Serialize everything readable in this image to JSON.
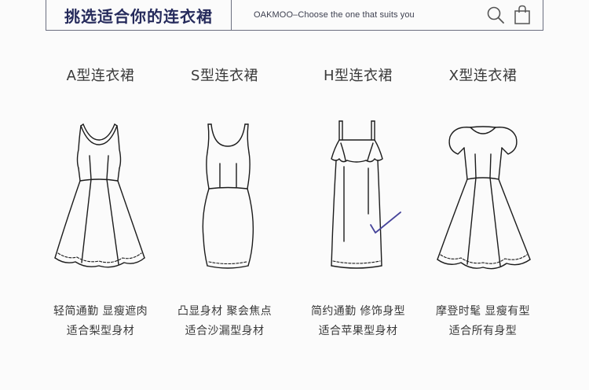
{
  "header": {
    "title": "挑选适合你的连衣裙",
    "search_text": "OAKMOO–Choose the one that suits you",
    "icons": [
      "search-icon",
      "shopping-bag-icon"
    ]
  },
  "styles": [
    {
      "title": "A型连衣裙",
      "line1": "轻简通勤 显瘦遮肉",
      "line2": "适合梨型身材"
    },
    {
      "title": "S型连衣裙",
      "line1": "凸显身材 聚会焦点",
      "line2": "适合沙漏型身材"
    },
    {
      "title": "H型连衣裙",
      "line1": "简约通勤 修饰身型",
      "line2": "适合苹果型身材"
    },
    {
      "title": "X型连衣裙",
      "line1": "摩登时髦 显瘦有型",
      "line2": "适合所有身型"
    }
  ],
  "colors": {
    "title_navy": "#262b5c",
    "border": "#6b6f80",
    "check_mark": "#46449a"
  }
}
